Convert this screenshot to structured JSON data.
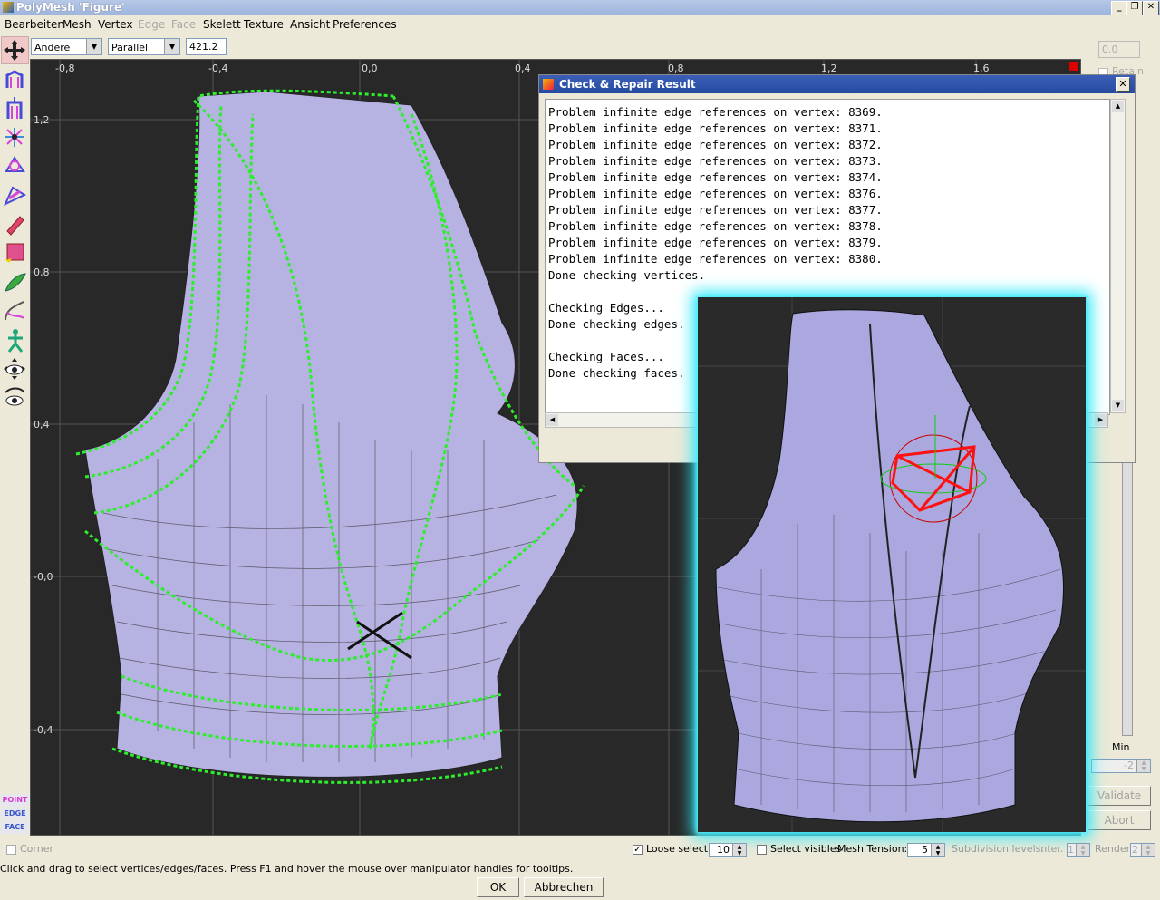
{
  "window": {
    "title": "PolyMesh 'Figure'",
    "min": "_",
    "max": "❐",
    "close": "✕"
  },
  "menu": [
    "Bearbeiten",
    "Mesh",
    "Vertex",
    "Edge",
    "Face",
    "Skelett",
    "Texture",
    "Ansicht",
    "Preferences"
  ],
  "toolbar": {
    "view_select": "Andere",
    "projection_select": "Parallel",
    "scale_value": "421.2"
  },
  "viewport": {
    "x_ticks": [
      "-0,8",
      "-0,4",
      "0,0",
      "0,4",
      "0,8",
      "1,2",
      "1,6"
    ],
    "y_ticks": [
      "1,2",
      "0,8",
      "0,4",
      "-0,0",
      "-0,4"
    ]
  },
  "modes": [
    "POINT",
    "EDGE",
    "FACE"
  ],
  "dialog": {
    "title": "Check & Repair Result",
    "close": "✕",
    "lines": [
      "Problem infinite edge references on vertex: 8369.",
      "Problem infinite edge references on vertex: 8371.",
      "Problem infinite edge references on vertex: 8372.",
      "Problem infinite edge references on vertex: 8373.",
      "Problem infinite edge references on vertex: 8374.",
      "Problem infinite edge references on vertex: 8376.",
      "Problem infinite edge references on vertex: 8377.",
      "Problem infinite edge references on vertex: 8378.",
      "Problem infinite edge references on vertex: 8379.",
      "Problem infinite edge references on vertex: 8380.",
      "Done checking vertices.",
      "",
      "Checking Edges...",
      "Done checking edges.",
      "",
      "Checking Faces...",
      "Done checking faces."
    ]
  },
  "right_panel": {
    "value_top": "0.0",
    "retain_label": "Retain",
    "min_label": "Min",
    "min_value": "-2",
    "validate": "Validate",
    "abort": "Abort"
  },
  "status": {
    "corner_label": "Corner",
    "loose_select_label": "Loose select",
    "loose_select_checked": true,
    "loose_select_value": "10",
    "select_visibles_label": "Select visibles",
    "mesh_tension_label": "Mesh Tension:",
    "mesh_tension_value": "5",
    "subdivision_label": "Subdivision levels:",
    "inter_label": "Inter.",
    "inter_value": "1",
    "render_label": "Render",
    "render_value": "2",
    "hint": "Click and drag to select vertices/edges/faces. Press F1 and hover the mouse over manipulator handles for tooltips.",
    "ok": "OK",
    "cancel": "Abbrechen"
  }
}
